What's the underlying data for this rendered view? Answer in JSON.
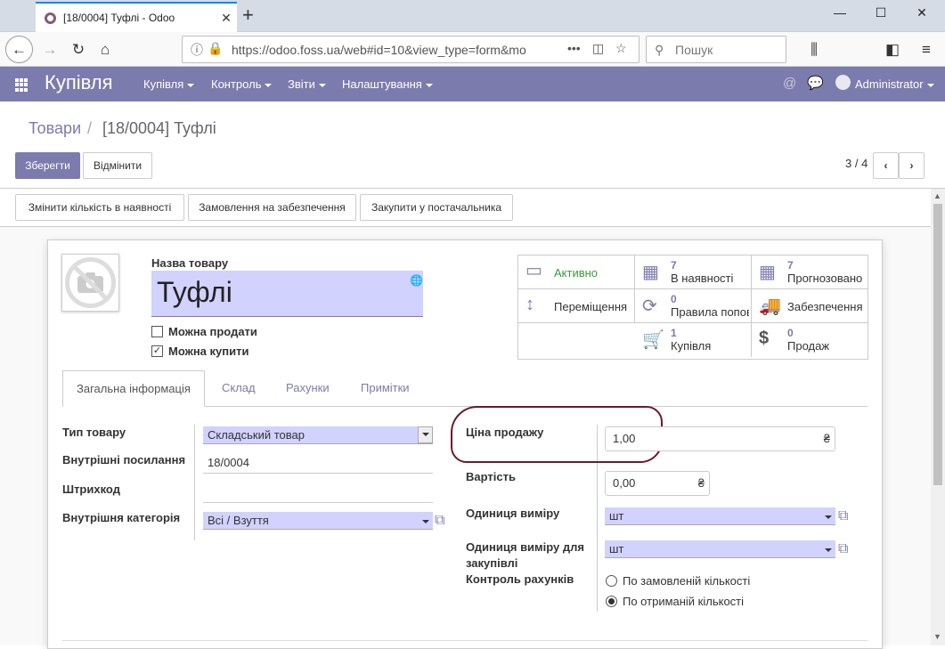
{
  "browser": {
    "tab_title": "[18/0004] Туфлі - Odoo",
    "new_tab": "+",
    "url": "https://odoo.foss.ua/web#id=10&view_type=form&mo",
    "search_placeholder": "Пошук",
    "url_dots": "•••"
  },
  "app": {
    "name": "Купівля",
    "menus": [
      "Купівля",
      "Контроль",
      "Звіти",
      "Налаштування"
    ],
    "user": "Administrator"
  },
  "breadcrumb": {
    "parent": "Товари",
    "separator": "/",
    "current": "[18/0004] Туфлі"
  },
  "actions": {
    "save": "Зберегти",
    "discard": "Відмінити",
    "pager": "3 / 4"
  },
  "statusbar": {
    "buttons": [
      "Змінити кількість в наявності",
      "Замовлення на забезпечення",
      "Закупити у постачальника"
    ]
  },
  "product": {
    "name_label": "Назва товару",
    "name": "Туфлі",
    "can_sell_label": "Можна продати",
    "can_sell": false,
    "can_buy_label": "Можна купити",
    "can_buy": true
  },
  "smart_buttons": {
    "active": "Активно",
    "moves": "Переміщення",
    "on_hand_count": "7",
    "on_hand_label": "В наявності",
    "forecast_count": "7",
    "forecast_label": "Прогнозовано",
    "rules_count": "0",
    "rules_label": "Правила поповнення",
    "replenish": "Забезпечення",
    "purchase_count": "1",
    "purchase_label": "Купівля",
    "sales_count": "0",
    "sales_label": "Продаж"
  },
  "tabs": [
    "Загальна інформація",
    "Склад",
    "Рахунки",
    "Примітки"
  ],
  "general": {
    "type_label": "Тип товару",
    "type_value": "Складський товар",
    "ref_label": "Внутрішні посилання",
    "ref_value": "18/0004",
    "barcode_label": "Штрихкод",
    "barcode_value": "",
    "categ_label": "Внутрішня категорія",
    "categ_value": "Всі / Взуття",
    "price_label": "Ціна продажу",
    "price_value": "1,00",
    "cost_label": "Вартість",
    "cost_value": "0,00",
    "currency": "₴",
    "uom_label": "Одиниця виміру",
    "uom_value": "шт",
    "po_uom_label": "Одиниця виміру для закупівлі",
    "po_uom_value": "шт",
    "bill_control_label": "Контроль рахунків",
    "bill_options": [
      "По замовленій кількості",
      "По отриманій кількості"
    ],
    "bill_selected": 1
  },
  "colors": {
    "brand": "#7c7bad",
    "required_field": "#d2d2ff",
    "annotation": "#6b1a2b"
  }
}
